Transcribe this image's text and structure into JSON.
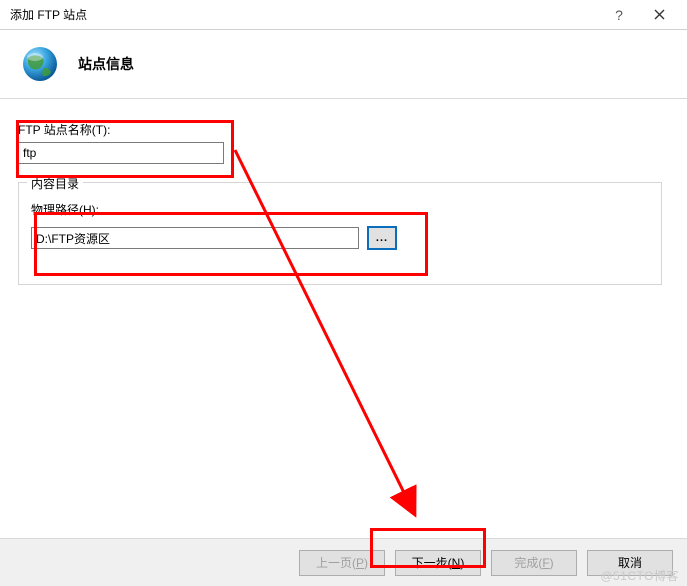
{
  "dialog": {
    "title": "添加 FTP 站点",
    "heading": "站点信息",
    "site_name_label": "FTP 站点名称(T):",
    "site_name_value": "ftp",
    "content_group_title": "内容目录",
    "physical_path_label": "物理路径(H):",
    "physical_path_value": "D:\\FTP资源区",
    "browse_label": "..."
  },
  "buttons": {
    "prev": "上一页(P)",
    "next": "下一步(N)",
    "finish": "完成(F)",
    "cancel": "取消"
  },
  "watermark": "@51CTO博客"
}
